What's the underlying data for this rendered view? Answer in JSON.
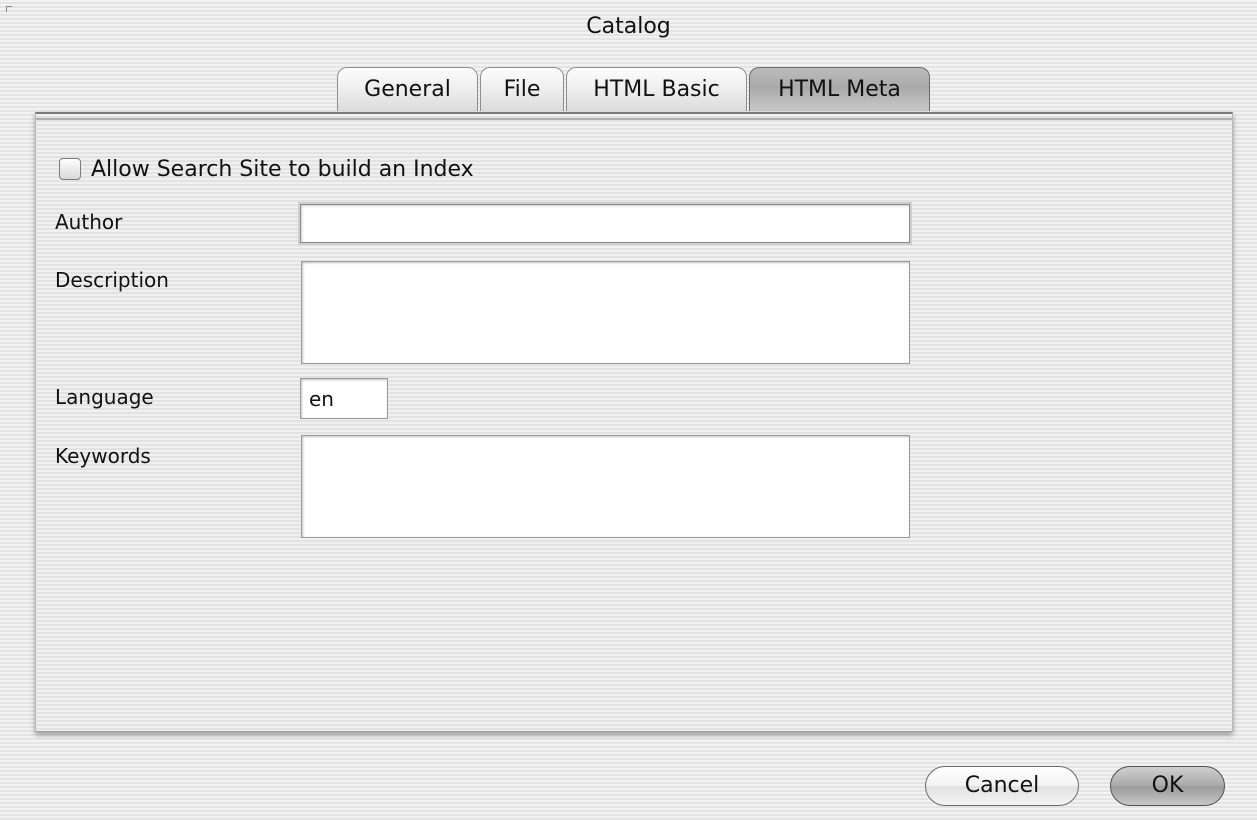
{
  "window": {
    "title": "Catalog"
  },
  "tabs": [
    {
      "label": "General",
      "active": false
    },
    {
      "label": "File",
      "active": false
    },
    {
      "label": "HTML Basic",
      "active": false
    },
    {
      "label": "HTML Meta",
      "active": true
    }
  ],
  "form": {
    "allow_index": {
      "label": "Allow Search Site to build an Index",
      "checked": false
    },
    "author": {
      "label": "Author",
      "value": ""
    },
    "description": {
      "label": "Description",
      "value": ""
    },
    "language": {
      "label": "Language",
      "value": "en"
    },
    "keywords": {
      "label": "Keywords",
      "value": ""
    }
  },
  "buttons": {
    "cancel": "Cancel",
    "ok": "OK"
  }
}
